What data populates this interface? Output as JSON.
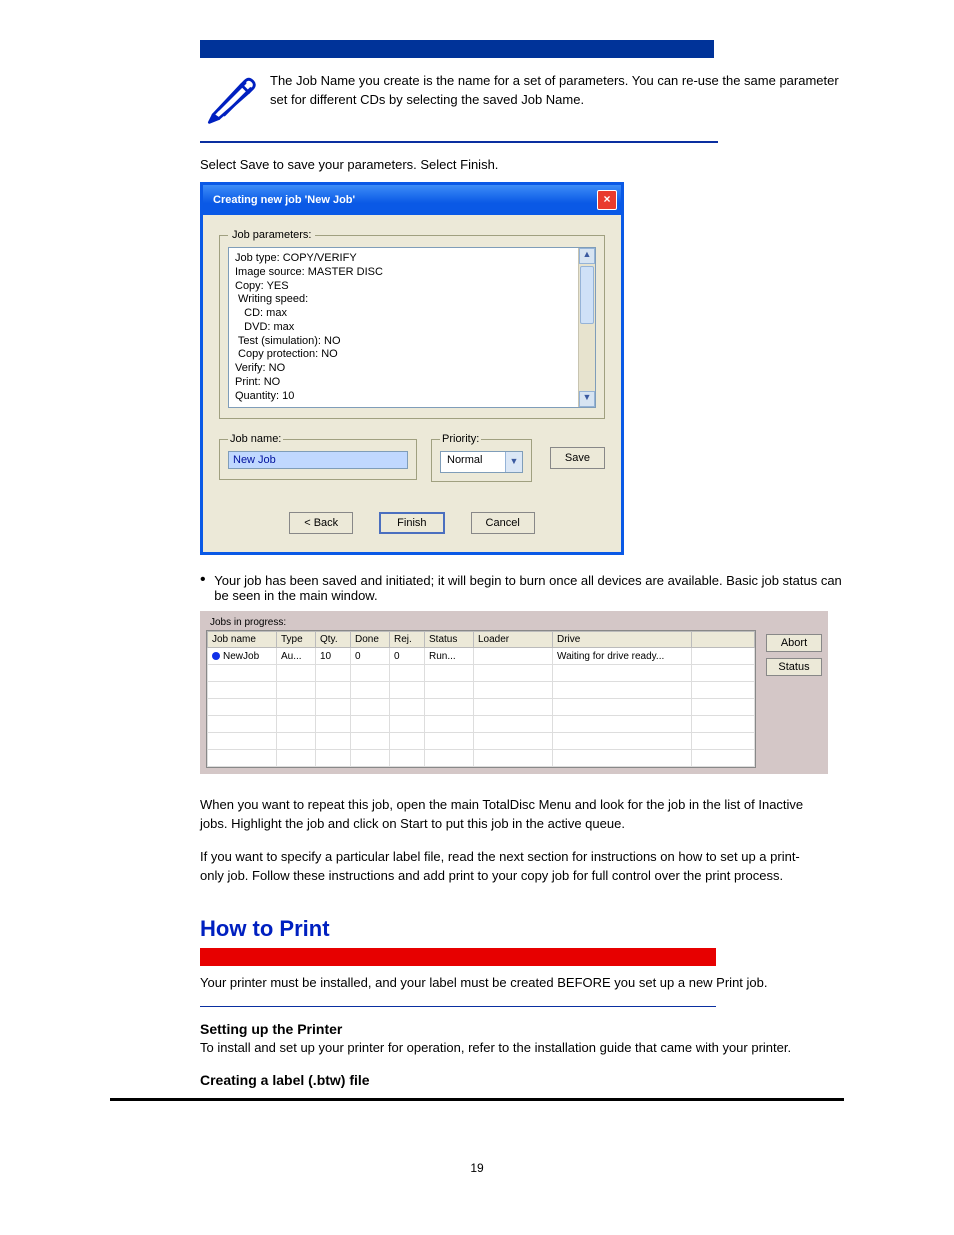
{
  "note": "The Job Name you create is the name for a set of parameters. You can re-use the same parameter set for different CDs by selecting the saved Job Name.",
  "step8": "Select Save to save your parameters. Select Finish.",
  "dialog": {
    "title": "Creating new job 'New Job'",
    "paramsLegend": "Job parameters:",
    "lines": "Job type: COPY/VERIFY\nImage source: MASTER DISC\nCopy: YES\n Writing speed:\n   CD: max\n   DVD: max\n Test (simulation): NO\n Copy protection: NO\nVerify: NO\nPrint: NO\nQuantity: 10",
    "jobNameLegend": "Job name:",
    "jobNameValue": "New Job",
    "priorityLegend": "Priority:",
    "priorityValue": "Normal",
    "saveBtn": "Save",
    "backBtn": "< Back",
    "finishBtn": "Finish",
    "cancelBtn": "Cancel"
  },
  "bullet1": "Your job has been saved and initiated; it will begin to burn once all devices are available. Basic job status can be seen in the main window.",
  "jobsPanel": {
    "title": "Jobs in progress:",
    "headers": [
      "Job name",
      "Type",
      "Qty.",
      "Done",
      "Rej.",
      "Status",
      "Loader",
      "Drive",
      ""
    ],
    "row": {
      "jobName": "NewJob",
      "type": "Au...",
      "qty": "10",
      "done": "0",
      "rej": "0",
      "status": "Run...",
      "loader": "",
      "drive": "Waiting for drive ready..."
    },
    "abortBtn": "Abort",
    "statusBtn": "Status"
  },
  "para2": "When you want to repeat this job, open the main TotalDisc Menu and look for the job in the list of Inactive jobs. Highlight the job and click on Start to put this job in the active queue.",
  "para3": "If you want to specify a particular label file, read the next section for instructions on how to set up a print-only job. Follow these instructions and add print to your copy job for full control over the print process.",
  "h2": "How to Print",
  "warnText": "Your printer must be installed, and your label must be created BEFORE you set up a new Print job.",
  "sub1": "Setting up the Printer",
  "sub1para": "To install and set up your printer for operation, refer to the installation guide that came with your printer.",
  "sub2": "Creating a label (.btw) file",
  "pageNum": "19"
}
